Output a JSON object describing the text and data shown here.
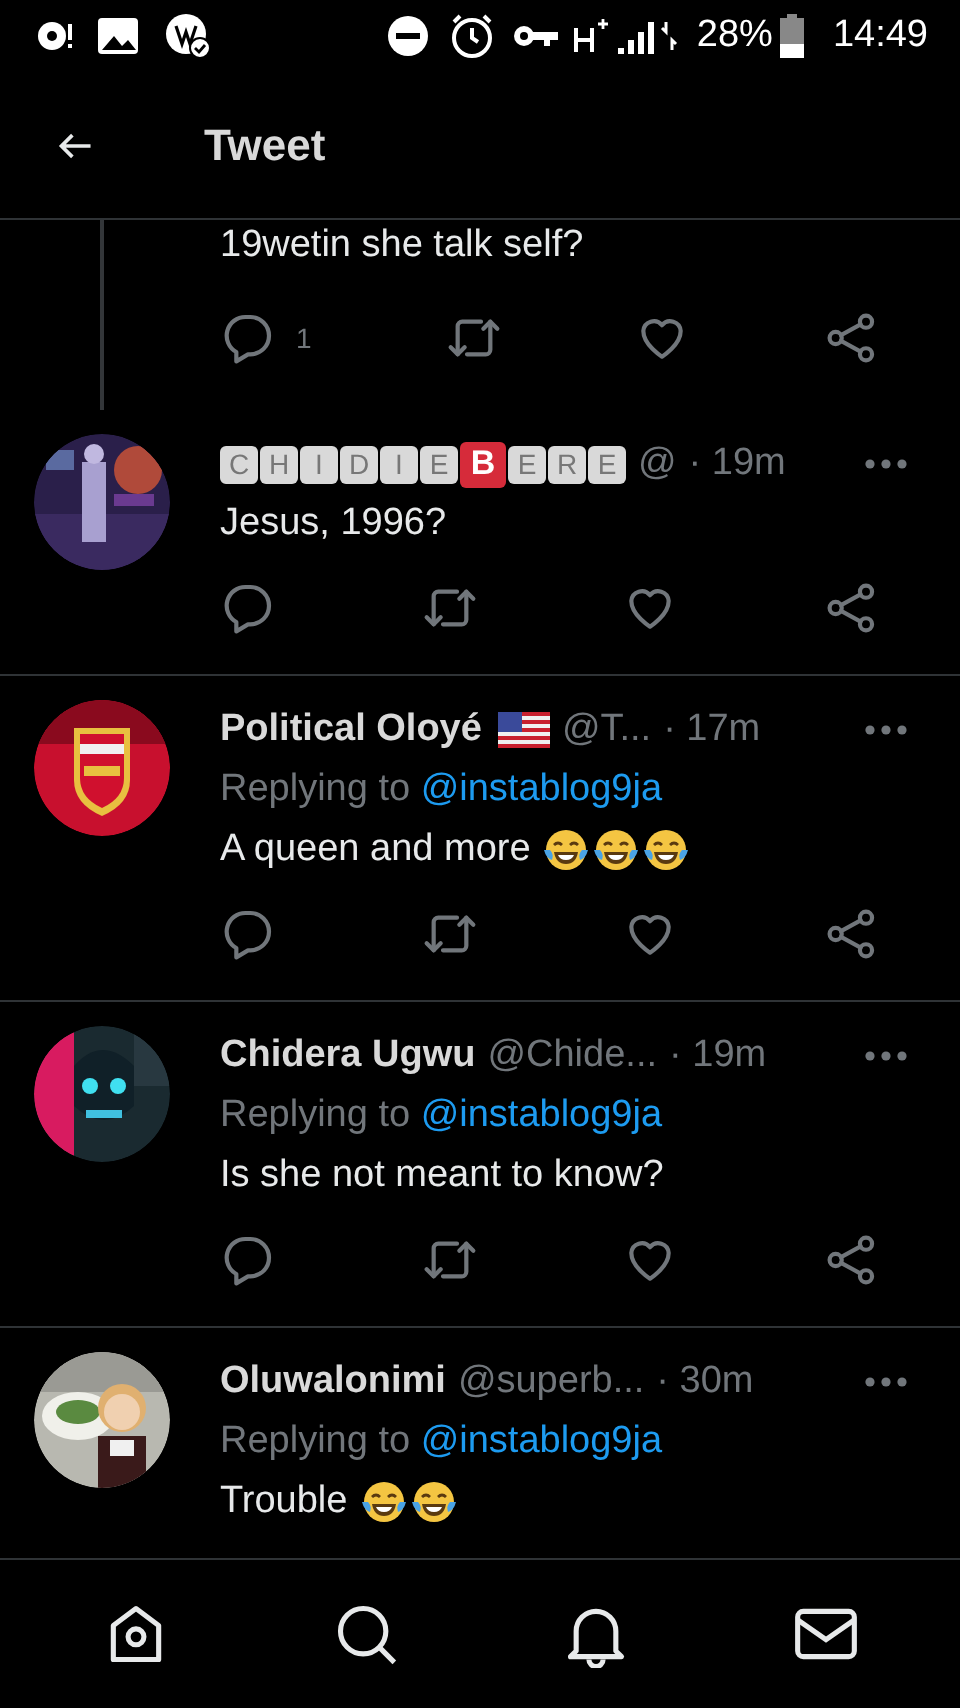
{
  "status_bar": {
    "battery": "28%",
    "time": "14:49"
  },
  "header": {
    "title": "Tweet"
  },
  "thread_tail": {
    "text": "19wetin she talk self?",
    "reply_count": "1"
  },
  "tweets": [
    {
      "kind": "boxed",
      "name_letters": [
        {
          "letter": "C",
          "highlight": false
        },
        {
          "letter": "H",
          "highlight": false
        },
        {
          "letter": "I",
          "highlight": false
        },
        {
          "letter": "D",
          "highlight": false
        },
        {
          "letter": "I",
          "highlight": false
        },
        {
          "letter": "E",
          "highlight": false
        },
        {
          "letter": "B",
          "highlight": true
        },
        {
          "letter": "E",
          "highlight": false
        },
        {
          "letter": "R",
          "highlight": false
        },
        {
          "letter": "E",
          "highlight": false
        }
      ],
      "handle": "@",
      "time": "· 19m",
      "text": "Jesus, 1996?"
    },
    {
      "kind": "plain",
      "name": "Political Oloyé",
      "flag": {
        "kind": "us"
      },
      "handle": "@T...",
      "time": "· 17m",
      "replying_label": "Replying to",
      "replying_to": "@instablog9ja",
      "text": "A queen and more",
      "emojis": [
        {
          "kind": "tears-of-joy"
        },
        {
          "kind": "tears-of-joy"
        },
        {
          "kind": "tears-of-joy"
        }
      ]
    },
    {
      "kind": "plain",
      "name": "Chidera Ugwu",
      "handle": "@Chide...",
      "time": "· 19m",
      "replying_label": "Replying to",
      "replying_to": "@instablog9ja",
      "text": "Is she not meant to know?"
    },
    {
      "kind": "plain",
      "name": "Oluwalonimi",
      "handle": "@superb...",
      "time": "· 30m",
      "replying_label": "Replying to",
      "replying_to": "@instablog9ja",
      "text": "Trouble",
      "emojis": [
        {
          "kind": "tears-of-joy"
        },
        {
          "kind": "tears-of-joy"
        }
      ]
    }
  ]
}
